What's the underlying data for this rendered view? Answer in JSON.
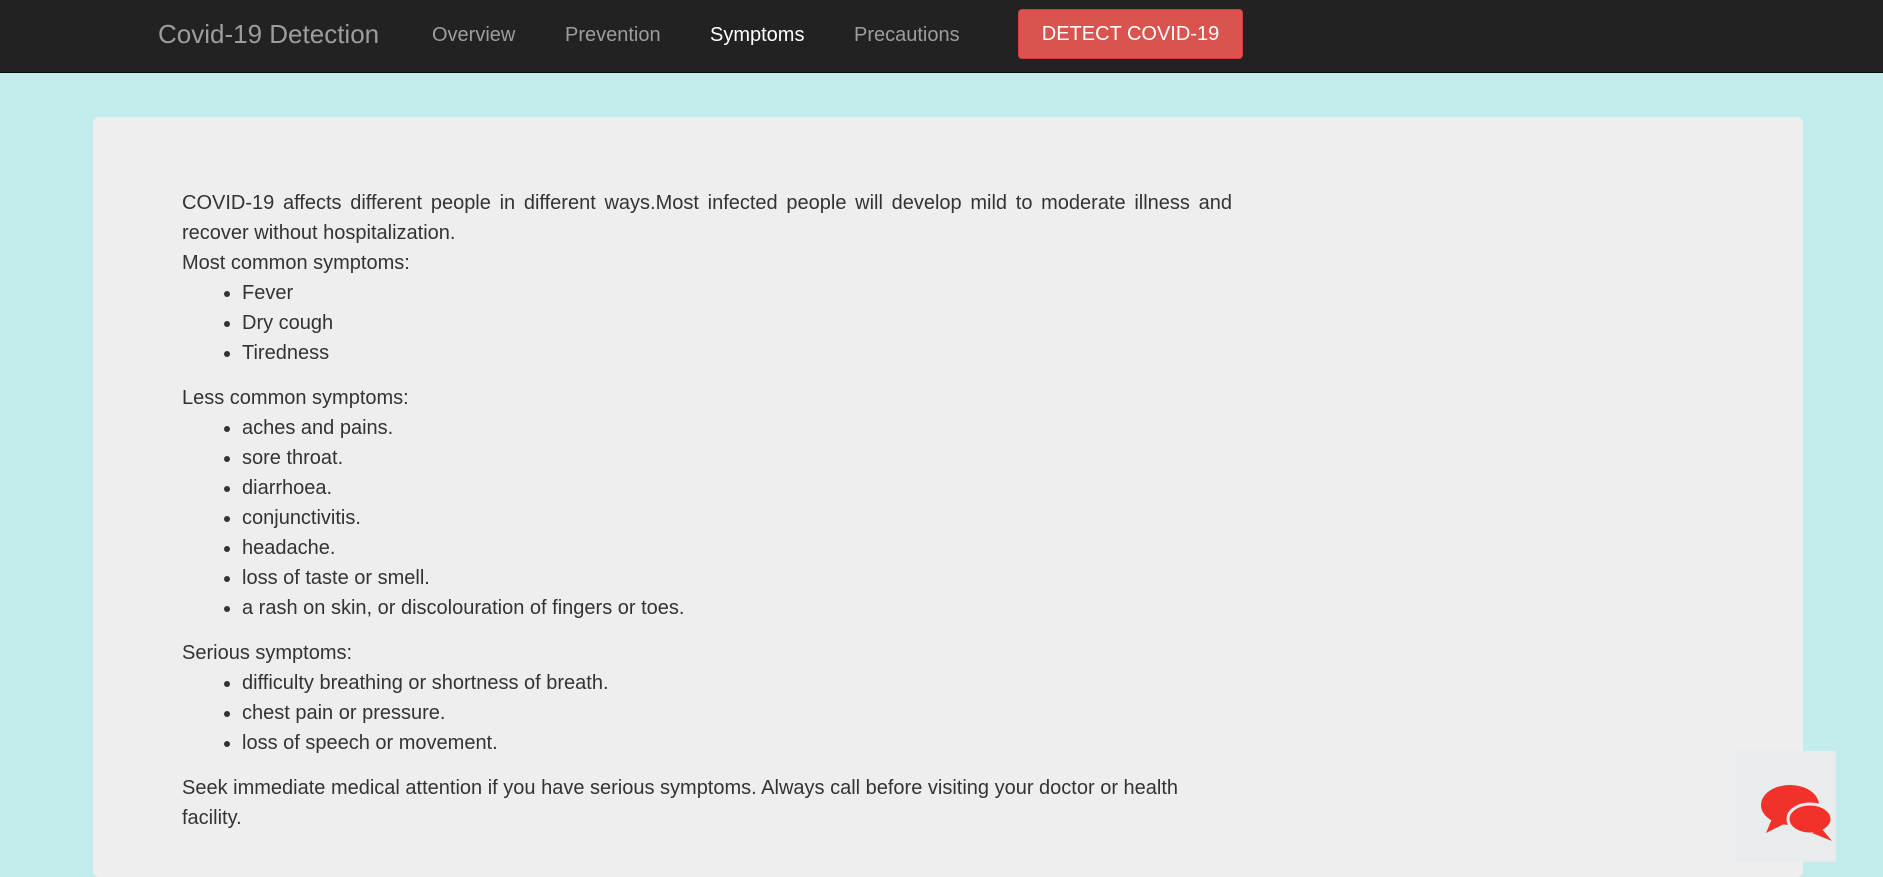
{
  "navbar": {
    "brand": "Covid-19 Detection",
    "links": [
      {
        "label": "Overview",
        "active": false
      },
      {
        "label": "Prevention",
        "active": false
      },
      {
        "label": "Symptoms",
        "active": true
      },
      {
        "label": "Precautions",
        "active": false
      }
    ],
    "detect_button": "DETECT COVID-19"
  },
  "content": {
    "intro": "COVID-19 affects different people in different ways.Most infected people will develop mild to moderate illness and recover without hospitalization.",
    "sections": [
      {
        "label": "Most common symptoms:",
        "items": [
          "Fever",
          "Dry cough",
          "Tiredness"
        ]
      },
      {
        "label": "Less common symptoms:",
        "items": [
          "aches and pains.",
          "sore throat.",
          "diarrhoea.",
          "conjunctivitis.",
          "headache.",
          "loss of taste or smell.",
          "a rash on skin, or discolouration of fingers or toes."
        ]
      },
      {
        "label": "Serious symptoms:",
        "items": [
          "difficulty breathing or shortness of breath.",
          "chest pain or pressure.",
          "loss of speech or movement."
        ]
      }
    ],
    "closing": "Seek immediate medical attention if you have serious symptoms. Always call before visiting your doctor or health facility."
  },
  "chat_widget": {
    "icon": "chat-bubbles-icon",
    "color": "#f2312b"
  },
  "colors": {
    "navbar_bg": "#222222",
    "page_bg": "#c3edec",
    "card_bg": "#eeeeee",
    "button_bg": "#d9534f"
  }
}
